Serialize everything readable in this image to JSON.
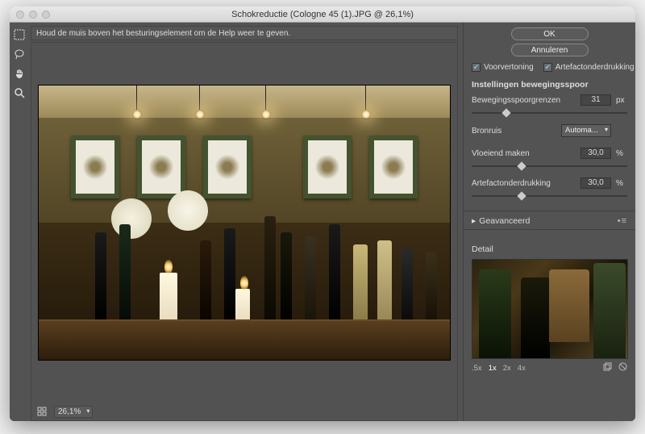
{
  "window": {
    "title": "Schokreductie (Cologne 45 (1).JPG @ 26,1%)"
  },
  "hint": "Houd de muis boven het besturingselement om de Help weer te geven.",
  "statusbar": {
    "zoom": "26,1%"
  },
  "panel": {
    "ok": "OK",
    "cancel": "Annuleren",
    "preview_chk": "Voorvertoning",
    "artifact_chk": "Artefactonderdrukking",
    "section": "Instellingen bewegingsspoor",
    "blur_bounds_label": "Bewegingsspoorgrenzen",
    "blur_bounds_value": "31",
    "blur_bounds_unit": "px",
    "source_noise_label": "Bronruis",
    "source_noise_value": "Automa...",
    "smooth_label": "Vloeiend maken",
    "smooth_value": "30,0",
    "smooth_unit": "%",
    "artifact_label": "Artefactonderdrukking",
    "artifact_value": "30,0",
    "artifact_unit": "%",
    "advanced": "Geavanceerd",
    "detail": "Detail",
    "zooms": {
      "z05": ".5x",
      "z1": "1x",
      "z2": "2x",
      "z4": "4x"
    }
  }
}
